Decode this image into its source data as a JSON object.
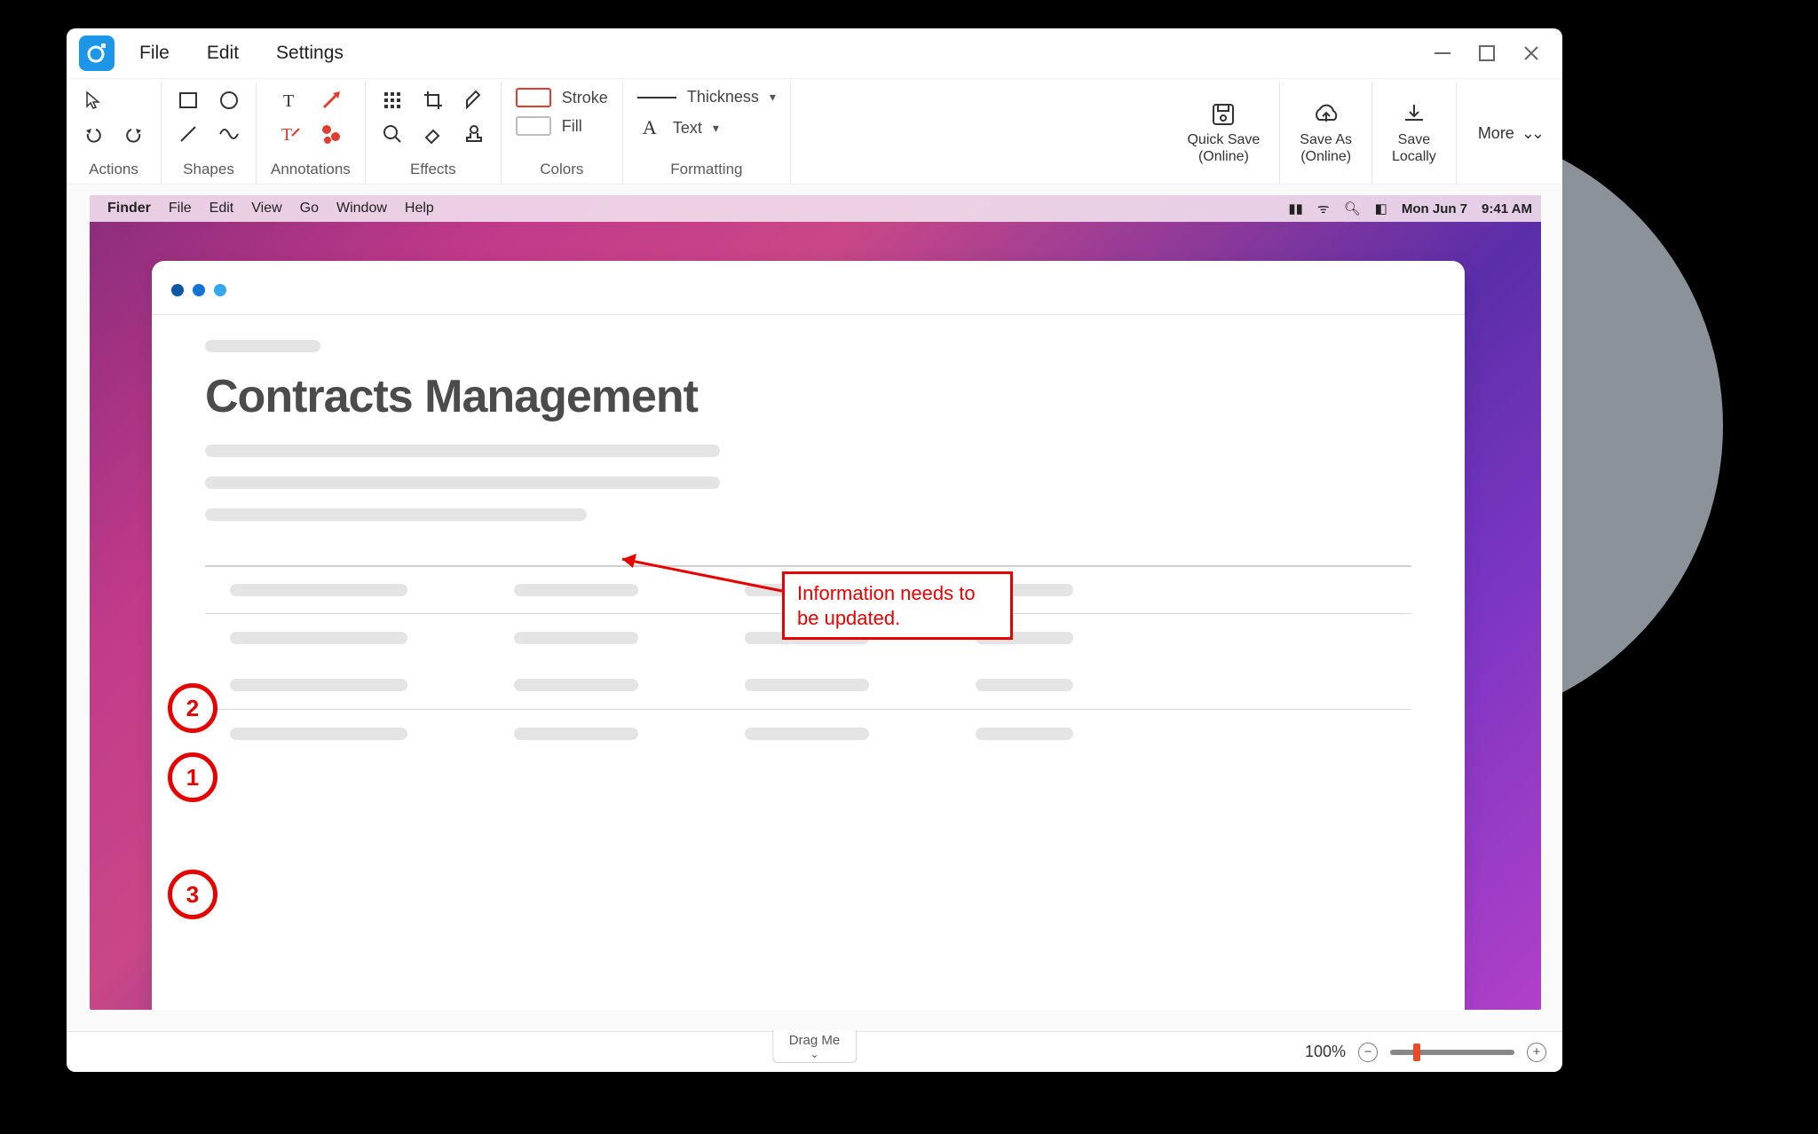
{
  "menubar": {
    "file": "File",
    "edit": "Edit",
    "settings": "Settings"
  },
  "toolbar": {
    "groups": {
      "actions": "Actions",
      "shapes": "Shapes",
      "annotations": "Annotations",
      "effects": "Effects",
      "colors": "Colors",
      "formatting": "Formatting"
    },
    "stroke_label": "Stroke",
    "fill_label": "Fill",
    "thickness_label": "Thickness",
    "text_label": "Text",
    "quick_save": "Quick Save",
    "quick_save_sub": "(Online)",
    "save_as": "Save As",
    "save_as_sub": "(Online)",
    "save_local": "Save",
    "save_local_sub": "Locally",
    "more": "More"
  },
  "mac_menubar": {
    "finder": "Finder",
    "file": "File",
    "edit": "Edit",
    "view": "View",
    "go": "Go",
    "window": "Window",
    "help": "Help",
    "date": "Mon Jun 7",
    "time": "9:41 AM"
  },
  "document": {
    "title": "Contracts Management"
  },
  "annotations": {
    "callout_text": "Information needs to be updated.",
    "step_2": "2",
    "step_1": "1",
    "step_3": "3"
  },
  "statusbar": {
    "drag": "Drag Me",
    "zoom": "100%"
  }
}
